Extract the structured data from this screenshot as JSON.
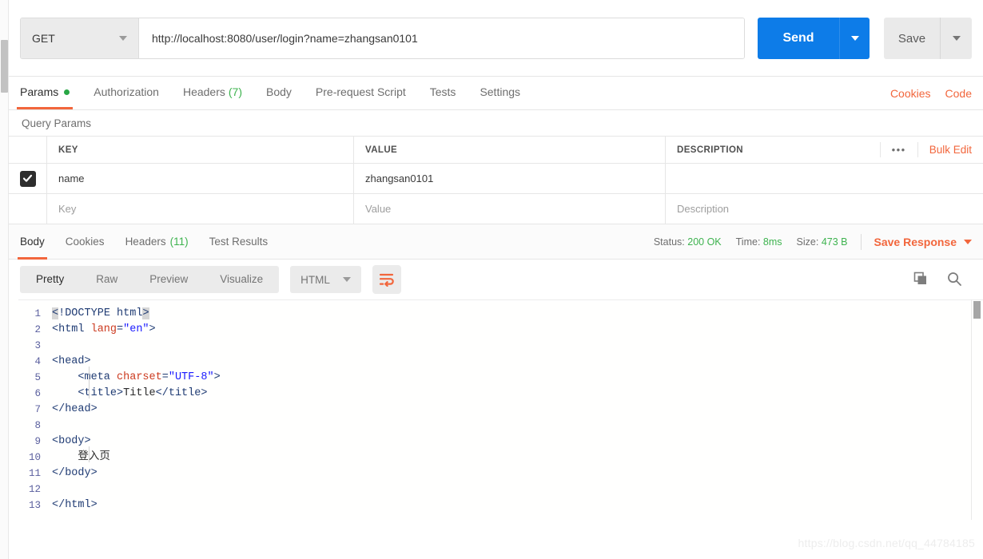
{
  "request": {
    "method": "GET",
    "method_icon": "chevron-down-icon",
    "url": "http://localhost:8080/user/login?name=zhangsan0101",
    "send_label": "Send",
    "send_caret_icon": "chevron-down-icon",
    "save_label": "Save",
    "save_caret_icon": "chevron-down-icon",
    "tabs": [
      {
        "label": "Params",
        "badge": "",
        "dot": true,
        "active": true
      },
      {
        "label": "Authorization",
        "badge": "",
        "dot": false,
        "active": false
      },
      {
        "label": "Headers",
        "badge": "(7)",
        "dot": false,
        "active": false
      },
      {
        "label": "Body",
        "badge": "",
        "dot": false,
        "active": false
      },
      {
        "label": "Pre-request Script",
        "badge": "",
        "dot": false,
        "active": false
      },
      {
        "label": "Tests",
        "badge": "",
        "dot": false,
        "active": false
      },
      {
        "label": "Settings",
        "badge": "",
        "dot": false,
        "active": false
      }
    ],
    "cookies_link": "Cookies",
    "code_link": "Code"
  },
  "query_params": {
    "section_title": "Query Params",
    "columns": [
      "KEY",
      "VALUE",
      "DESCRIPTION"
    ],
    "more_icon": "ellipsis-icon",
    "bulk_edit_label": "Bulk Edit",
    "rows": [
      {
        "checked": true,
        "key": "name",
        "value": "zhangsan0101",
        "description": ""
      }
    ],
    "placeholders": {
      "key": "Key",
      "value": "Value",
      "description": "Description"
    }
  },
  "response": {
    "tabs": [
      {
        "label": "Body",
        "badge": "",
        "active": true
      },
      {
        "label": "Cookies",
        "badge": "",
        "active": false
      },
      {
        "label": "Headers",
        "badge": "(11)",
        "active": false
      },
      {
        "label": "Test Results",
        "badge": "",
        "active": false
      }
    ],
    "status_label": "Status:",
    "status_value": "200 OK",
    "time_label": "Time:",
    "time_value": "8ms",
    "size_label": "Size:",
    "size_value": "473 B",
    "save_response_label": "Save Response",
    "save_response_caret_icon": "chevron-down-icon",
    "view_modes": [
      {
        "label": "Pretty",
        "active": true
      },
      {
        "label": "Raw",
        "active": false
      },
      {
        "label": "Preview",
        "active": false
      },
      {
        "label": "Visualize",
        "active": false
      }
    ],
    "format": "HTML",
    "format_caret_icon": "chevron-down-icon",
    "wrap_icon": "word-wrap-icon",
    "copy_icon": "copy-icon",
    "search_icon": "search-icon"
  },
  "code": {
    "language": "html",
    "lines": [
      {
        "n": "1",
        "tokens": [
          {
            "t": "<",
            "c": "tg match"
          },
          {
            "t": "!DOCTYPE html",
            "c": "tg"
          },
          {
            "t": ">",
            "c": "tg match"
          }
        ]
      },
      {
        "n": "2",
        "tokens": [
          {
            "t": "<html ",
            "c": "tg"
          },
          {
            "t": "lang",
            "c": "at"
          },
          {
            "t": "=",
            "c": "tg"
          },
          {
            "t": "\"en\"",
            "c": "st"
          },
          {
            "t": ">",
            "c": "tg"
          }
        ]
      },
      {
        "n": "3",
        "tokens": []
      },
      {
        "n": "4",
        "tokens": [
          {
            "t": "<head>",
            "c": "tg"
          }
        ]
      },
      {
        "n": "5",
        "tokens": [
          {
            "t": "    <meta ",
            "c": "tg"
          },
          {
            "t": "charset",
            "c": "at"
          },
          {
            "t": "=",
            "c": "tg"
          },
          {
            "t": "\"UTF-8\"",
            "c": "st"
          },
          {
            "t": ">",
            "c": "tg"
          }
        ]
      },
      {
        "n": "6",
        "tokens": [
          {
            "t": "    <title>",
            "c": "tg"
          },
          {
            "t": "Title",
            "c": "tx"
          },
          {
            "t": "</title>",
            "c": "tg"
          }
        ]
      },
      {
        "n": "7",
        "tokens": [
          {
            "t": "</head>",
            "c": "tg"
          }
        ]
      },
      {
        "n": "8",
        "tokens": []
      },
      {
        "n": "9",
        "tokens": [
          {
            "t": "<body>",
            "c": "tg"
          }
        ]
      },
      {
        "n": "10",
        "tokens": [
          {
            "t": "    登入页",
            "c": "tx"
          }
        ]
      },
      {
        "n": "11",
        "tokens": [
          {
            "t": "</body>",
            "c": "tg"
          }
        ]
      },
      {
        "n": "12",
        "tokens": []
      },
      {
        "n": "13",
        "tokens": [
          {
            "t": "</html>",
            "c": "tg"
          }
        ]
      }
    ]
  },
  "watermark": "https://blog.csdn.net/qq_44784185",
  "colors": {
    "accent_orange": "#f2663c",
    "send_blue": "#0d7ce8",
    "status_green": "#3eb34f",
    "dot_green": "#28a745"
  }
}
